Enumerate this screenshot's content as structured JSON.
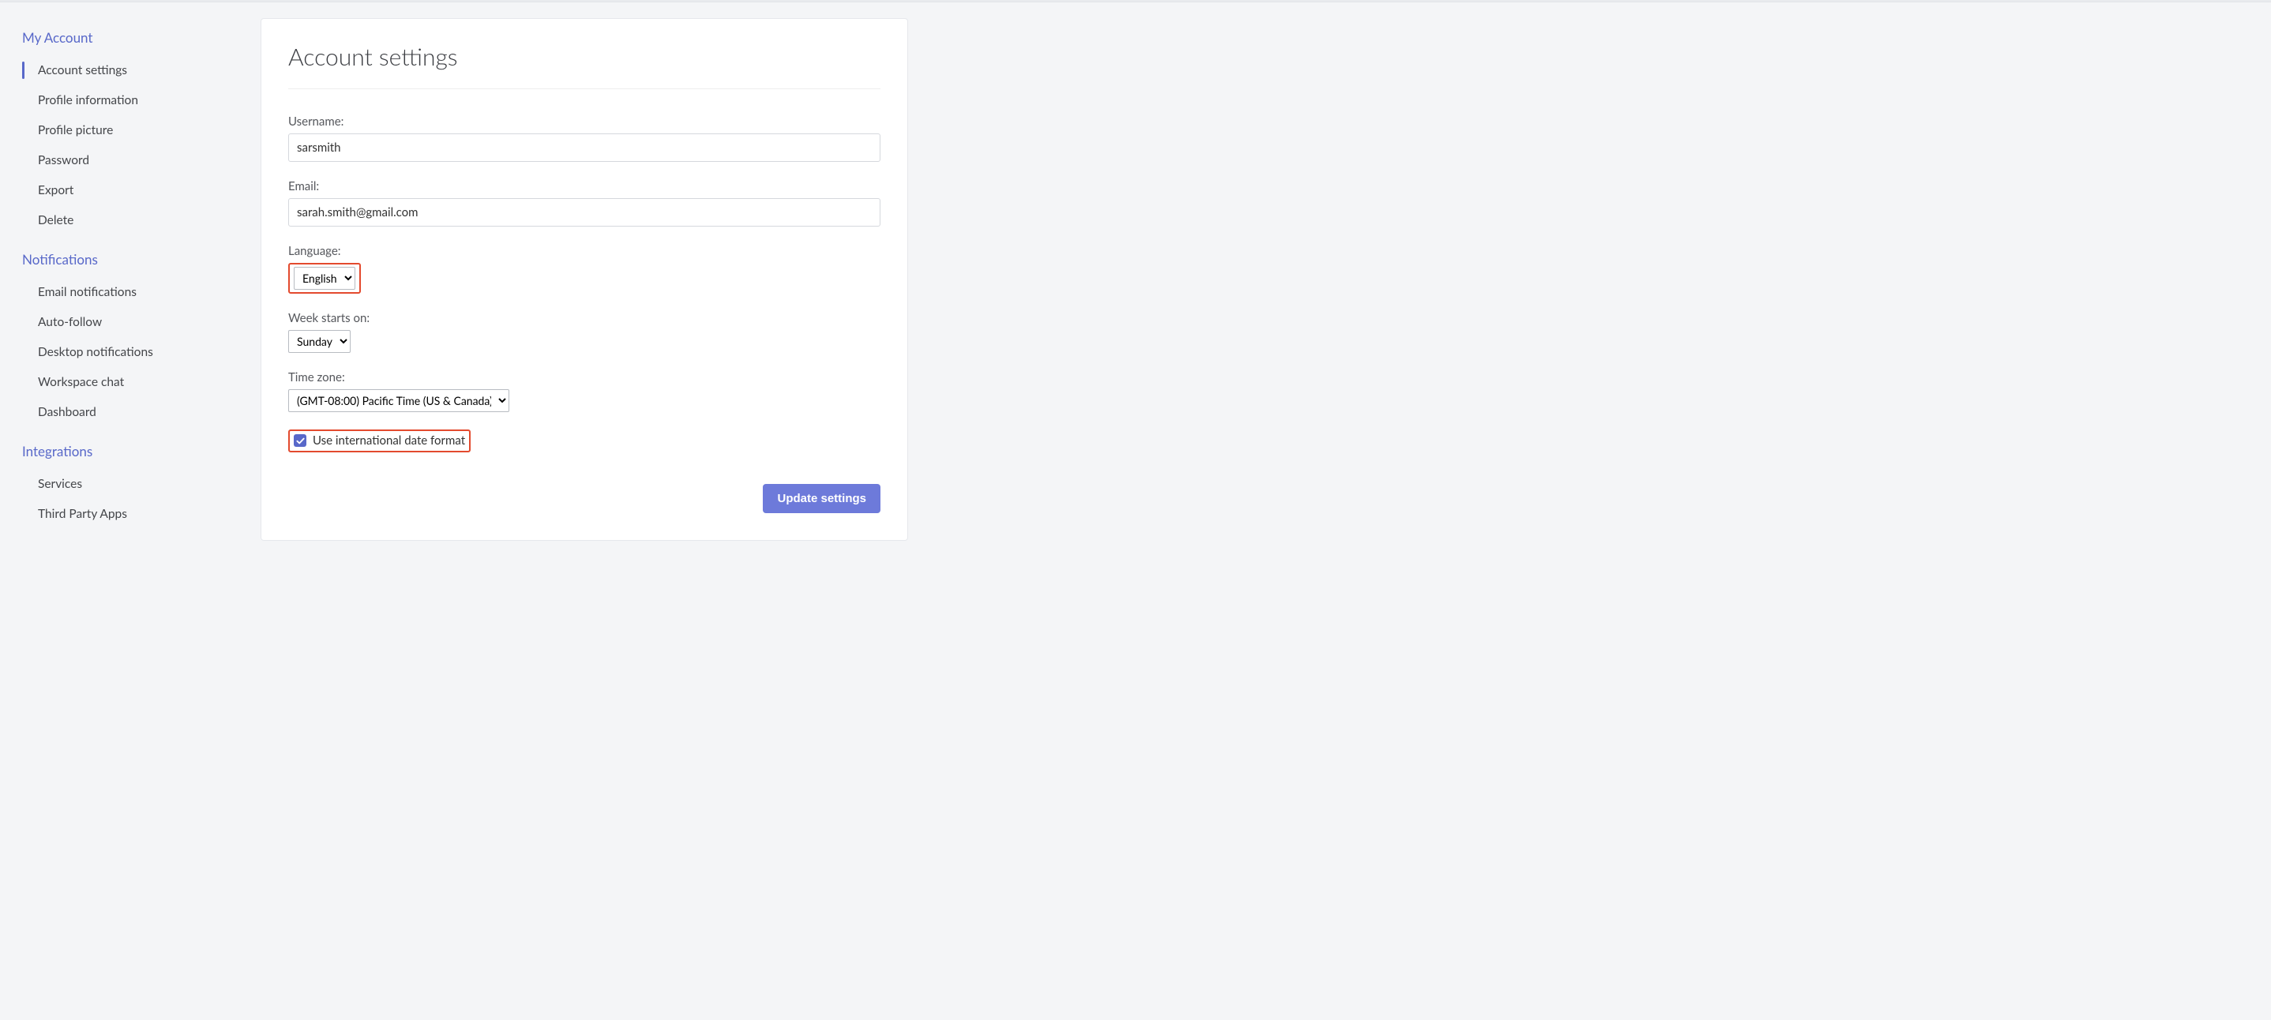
{
  "sidebar": {
    "sections": [
      {
        "heading": "My Account",
        "items": [
          {
            "label": "Account settings",
            "active": true
          },
          {
            "label": "Profile information"
          },
          {
            "label": "Profile picture"
          },
          {
            "label": "Password"
          },
          {
            "label": "Export"
          },
          {
            "label": "Delete"
          }
        ]
      },
      {
        "heading": "Notifications",
        "items": [
          {
            "label": "Email notifications"
          },
          {
            "label": "Auto-follow"
          },
          {
            "label": "Desktop notifications"
          },
          {
            "label": "Workspace chat"
          },
          {
            "label": "Dashboard"
          }
        ]
      },
      {
        "heading": "Integrations",
        "items": [
          {
            "label": "Services"
          },
          {
            "label": "Third Party Apps"
          }
        ]
      }
    ]
  },
  "main": {
    "title": "Account settings",
    "form": {
      "username": {
        "label": "Username:",
        "value": "sarsmith"
      },
      "email": {
        "label": "Email:",
        "value": "sarah.smith@gmail.com"
      },
      "language": {
        "label": "Language:",
        "value": "English"
      },
      "week": {
        "label": "Week starts on:",
        "value": "Sunday"
      },
      "timezone": {
        "label": "Time zone:",
        "value": "(GMT-08:00) Pacific Time (US & Canada)"
      },
      "intl_date": {
        "label": "Use international date format",
        "checked": true
      },
      "submit_label": "Update settings"
    }
  }
}
